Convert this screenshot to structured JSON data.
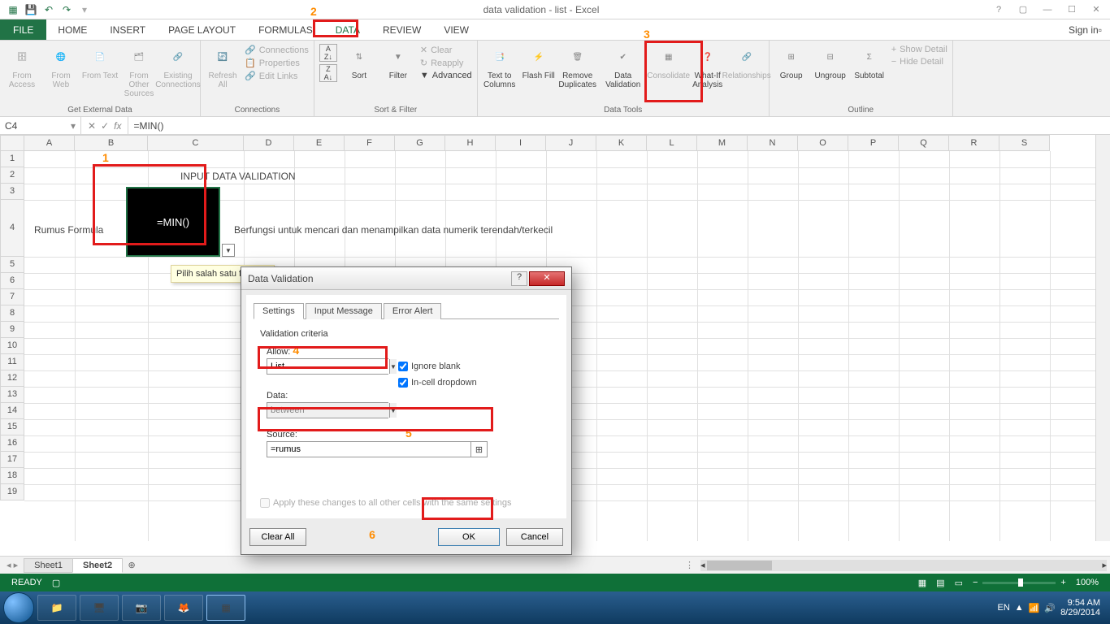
{
  "title": "data validation - list - Excel",
  "tabs": {
    "file": "FILE",
    "home": "HOME",
    "insert": "INSERT",
    "pagelayout": "PAGE LAYOUT",
    "formulas": "FORMULAS",
    "data": "DATA",
    "review": "REVIEW",
    "view": "VIEW",
    "signin": "Sign in"
  },
  "ribbon": {
    "getext": {
      "label": "Get External Data",
      "access": "From Access",
      "web": "From Web",
      "text": "From Text",
      "other": "From Other Sources",
      "existing": "Existing Connections"
    },
    "conn": {
      "label": "Connections",
      "refresh": "Refresh All",
      "connections": "Connections",
      "properties": "Properties",
      "editlinks": "Edit Links"
    },
    "sortfilter": {
      "label": "Sort & Filter",
      "sortaz": "A↓Z",
      "sortza": "Z↓A",
      "sort": "Sort",
      "filter": "Filter",
      "clear": "Clear",
      "reapply": "Reapply",
      "advanced": "Advanced"
    },
    "datatools": {
      "label": "Data Tools",
      "t2c": "Text to Columns",
      "flash": "Flash Fill",
      "remdup": "Remove Duplicates",
      "dataval": "Data Validation",
      "consolidate": "Consolidate",
      "whatif": "What-If Analysis",
      "relations": "Relationships"
    },
    "outline": {
      "label": "Outline",
      "group": "Group",
      "ungroup": "Ungroup",
      "subtotal": "Subtotal",
      "showdet": "Show Detail",
      "hidedet": "Hide Detail"
    }
  },
  "namebox": "C4",
  "formula": "=MIN()",
  "columns": [
    "A",
    "B",
    "C",
    "D",
    "E",
    "F",
    "G",
    "H",
    "I",
    "J",
    "K",
    "L",
    "M",
    "N",
    "O",
    "P",
    "Q",
    "R",
    "S"
  ],
  "rows": [
    "1",
    "2",
    "3",
    "4",
    "5",
    "6",
    "7",
    "8",
    "9",
    "10",
    "11",
    "12",
    "13",
    "14",
    "15",
    "16",
    "17",
    "18",
    "19"
  ],
  "cells": {
    "D2": "INPUT DATA VALIDATION",
    "B4": "Rumus Formula",
    "C4": "=MIN()",
    "E4": "Berfungsi untuk mencari dan menampilkan data numerik terendah/terkecil",
    "tooltip": "Pilih salah satu formula"
  },
  "markers": {
    "1": "1",
    "2": "2",
    "3": "3",
    "4": "4",
    "5": "5",
    "6": "6"
  },
  "sheets": {
    "s1": "Sheet1",
    "s2": "Sheet2"
  },
  "status": {
    "ready": "READY",
    "zoom": "100%"
  },
  "dialog": {
    "title": "Data Validation",
    "tabs": {
      "settings": "Settings",
      "input": "Input Message",
      "error": "Error Alert"
    },
    "criteria": "Validation criteria",
    "allow": "Allow:",
    "allow_val": "List",
    "data": "Data:",
    "data_val": "between",
    "source": "Source:",
    "source_val": "=rumus",
    "ignore": "Ignore blank",
    "incell": "In-cell dropdown",
    "applyall": "Apply these changes to all other cells with the same settings",
    "clear": "Clear All",
    "ok": "OK",
    "cancel": "Cancel"
  },
  "tray": {
    "lang": "EN",
    "time": "9:54 AM",
    "date": "8/29/2014"
  }
}
